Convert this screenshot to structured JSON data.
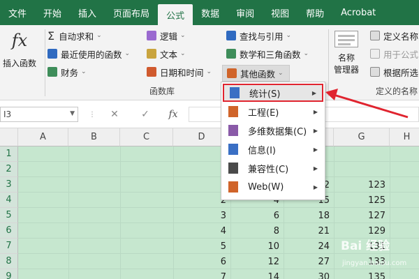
{
  "tabs": [
    "文件",
    "开始",
    "插入",
    "页面布局",
    "公式",
    "数据",
    "审阅",
    "视图",
    "帮助",
    "Acrobat"
  ],
  "active_tab_index": 4,
  "ribbon": {
    "insert_function": {
      "icon": "fx",
      "label": "插入函数"
    },
    "autosum": "自动求和",
    "recent": "最近使用的函数",
    "finance": "财务",
    "logic": "逻辑",
    "text": "文本",
    "datetime": "日期和时间",
    "lookup": "查找与引用",
    "math": "数学和三角函数",
    "other": "其他函数",
    "group_label": "函数库",
    "name_manager_line1": "名称",
    "name_manager_line2": "管理器",
    "define_name": "定义名称",
    "use_in_formula": "用于公式",
    "create_from_sel": "根据所选",
    "defined_names_label": "定义的名称"
  },
  "formula_bar": {
    "name_box": "I3",
    "cancel": "✕",
    "enter": "✓",
    "fx": "fx"
  },
  "columns": [
    "A",
    "B",
    "C",
    "D",
    "E",
    "F",
    "G",
    "H"
  ],
  "rows": [
    "1",
    "2",
    "3",
    "4",
    "5",
    "6",
    "7",
    "8",
    "9"
  ],
  "cells": {
    "D": [
      "",
      "",
      "",
      "2",
      "3",
      "4",
      "5",
      "6",
      "7"
    ],
    "E": [
      "",
      "",
      "",
      "4",
      "6",
      "8",
      "10",
      "12",
      "14"
    ],
    "F": [
      "",
      "",
      "12",
      "15",
      "18",
      "21",
      "24",
      "27",
      "30"
    ],
    "G": [
      "",
      "",
      "123",
      "125",
      "127",
      "129",
      "131",
      "133",
      "135"
    ]
  },
  "menu": [
    {
      "label": "统计(S)",
      "color": "#3a6fc4"
    },
    {
      "label": "工程(E)",
      "color": "#d0642a"
    },
    {
      "label": "多维数据集(C)",
      "color": "#8a5aa8"
    },
    {
      "label": "信息(I)",
      "color": "#3a6fc4"
    },
    {
      "label": "兼容性(C)",
      "color": "#4a4a4a"
    },
    {
      "label": "Web(W)",
      "color": "#d0642a"
    }
  ],
  "watermark": {
    "line1": "Bai 经验",
    "line2": "jingyan.baidu.com"
  },
  "colors": {
    "brand": "#217346",
    "highlight": "#e0242f",
    "selection_fill": "#c6e7cf"
  }
}
